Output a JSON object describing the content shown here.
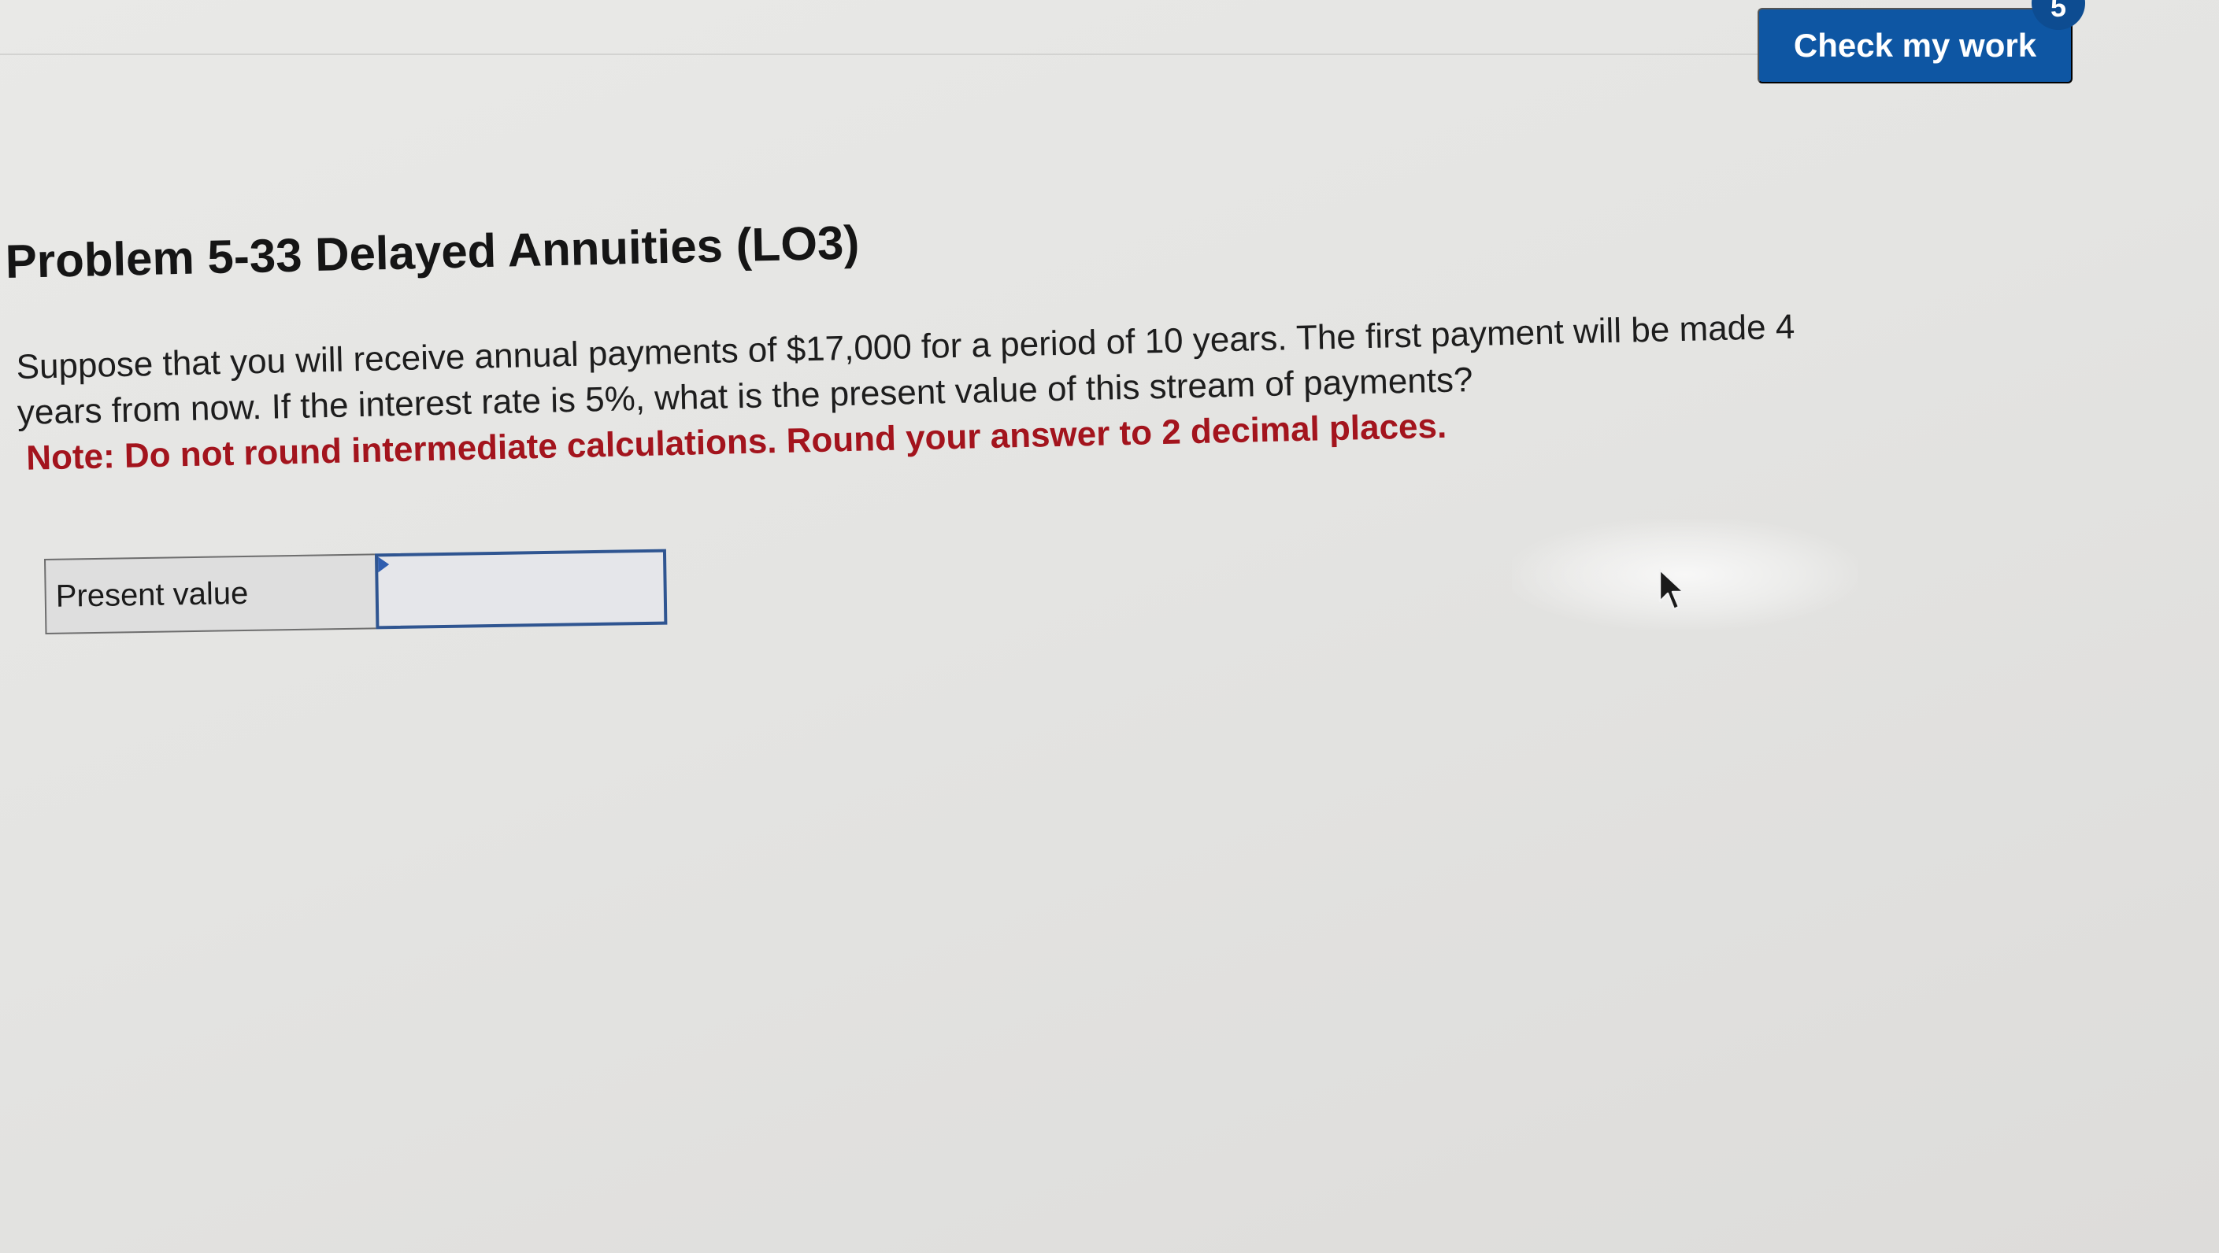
{
  "toolbar": {
    "check_label": "Check my work",
    "badge_count": "5"
  },
  "problem": {
    "title": "Problem 5-33 Delayed Annuities (LO3)",
    "question_line1": "Suppose that you will receive annual payments of $17,000 for a period of 10 years. The first payment will be made 4",
    "question_line2": "years from now. If the interest rate is 5%, what is the present value of this stream of payments?",
    "note": "Note: Do not round intermediate calculations. Round your answer to 2 decimal places."
  },
  "answer": {
    "label": "Present value",
    "value": "",
    "placeholder": ""
  },
  "icons": {
    "cursor": "arrow-cursor-icon",
    "input_flag": "flag-icon"
  },
  "colors": {
    "button": "#0e56a3",
    "note": "#a3141d",
    "input_border": "#2f5591"
  }
}
